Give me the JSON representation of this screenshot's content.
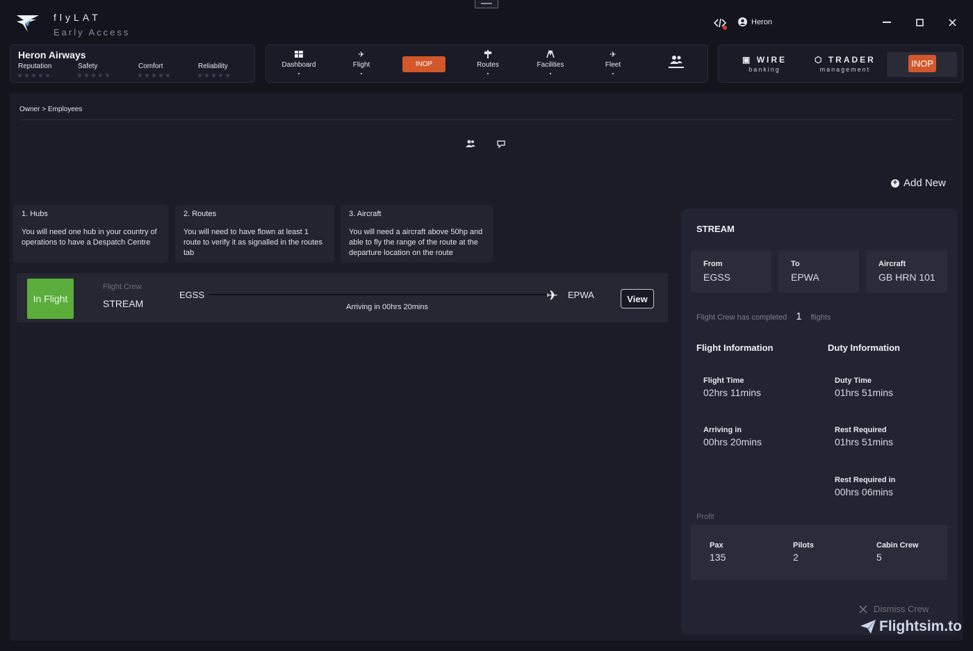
{
  "app": {
    "title": "flyLAT",
    "subtitle": "Early Access"
  },
  "titlebar": {
    "user": "Heron",
    "minimize": "—",
    "maximize": "□",
    "close": "✕"
  },
  "airline": {
    "name": "Heron Airways",
    "metrics": [
      {
        "label": "Reputation",
        "rating": 0
      },
      {
        "label": "Safety",
        "rating": 0
      },
      {
        "label": "Comfort",
        "rating": 0
      },
      {
        "label": "Reliability",
        "rating": 0
      }
    ]
  },
  "nav": {
    "dashboard": "Dashboard",
    "flight": "Flight",
    "inop": "INOP",
    "routes": "Routes",
    "facilities": "Facilities",
    "fleet": "Fleet"
  },
  "right_nav": {
    "wire_main": "WIRE",
    "wire_sub": "banking",
    "trader_main": "TRADER",
    "trader_sub": "management",
    "inop": "INOP"
  },
  "breadcrumb": "Owner > Employees",
  "add_new": "Add New",
  "requirements": [
    {
      "title": "1. Hubs",
      "body": "You will need one hub in your country of operations to have a Despatch Centre"
    },
    {
      "title": "2. Routes",
      "body": "You will need to have flown at least 1 route to verify it as signalled in the routes tab"
    },
    {
      "title": "3. Aircraft",
      "body": "You will need a aircraft above 50hp and able to fly the range of the route at the departure location on the route"
    }
  ],
  "flight": {
    "status": "In Flight",
    "crew_label": "Flight Crew",
    "crew_name": "STREAM",
    "origin": "EGSS",
    "destination": "EPWA",
    "arriving": "Arriving in 00hrs 20mins",
    "view": "View"
  },
  "details": {
    "title": "STREAM",
    "from_label": "From",
    "from": "EGSS",
    "to_label": "To",
    "to": "EPWA",
    "aircraft_label": "Aircraft",
    "aircraft": "GB HRN 101",
    "completed_prefix": "Flight Crew has completed",
    "completed_count": "1",
    "completed_suffix": "flights",
    "flight_info_title": "Flight Information",
    "duty_info_title": "Duty Information",
    "flight_time_label": "Flight Time",
    "flight_time": "02hrs 11mins",
    "arriving_label": "Arriving in",
    "arriving": "00hrs 20mins",
    "duty_time_label": "Duty Time",
    "duty_time": "01hrs 51mins",
    "rest_label": "Rest Required",
    "rest": "01hrs 51mins",
    "rest_in_label": "Rest Required in",
    "rest_in": "00hrs 06mins",
    "profit_label": "Profit",
    "pax_label": "Pax",
    "pax": "135",
    "pilots_label": "Pilots",
    "pilots": "2",
    "cabin_label": "Cabin Crew",
    "cabin": "5",
    "dismiss": "Dismiss Crew"
  },
  "watermark": "Flightsim.to",
  "colors": {
    "accent_inop": "#d2572a",
    "status_green": "#5bae3c"
  }
}
